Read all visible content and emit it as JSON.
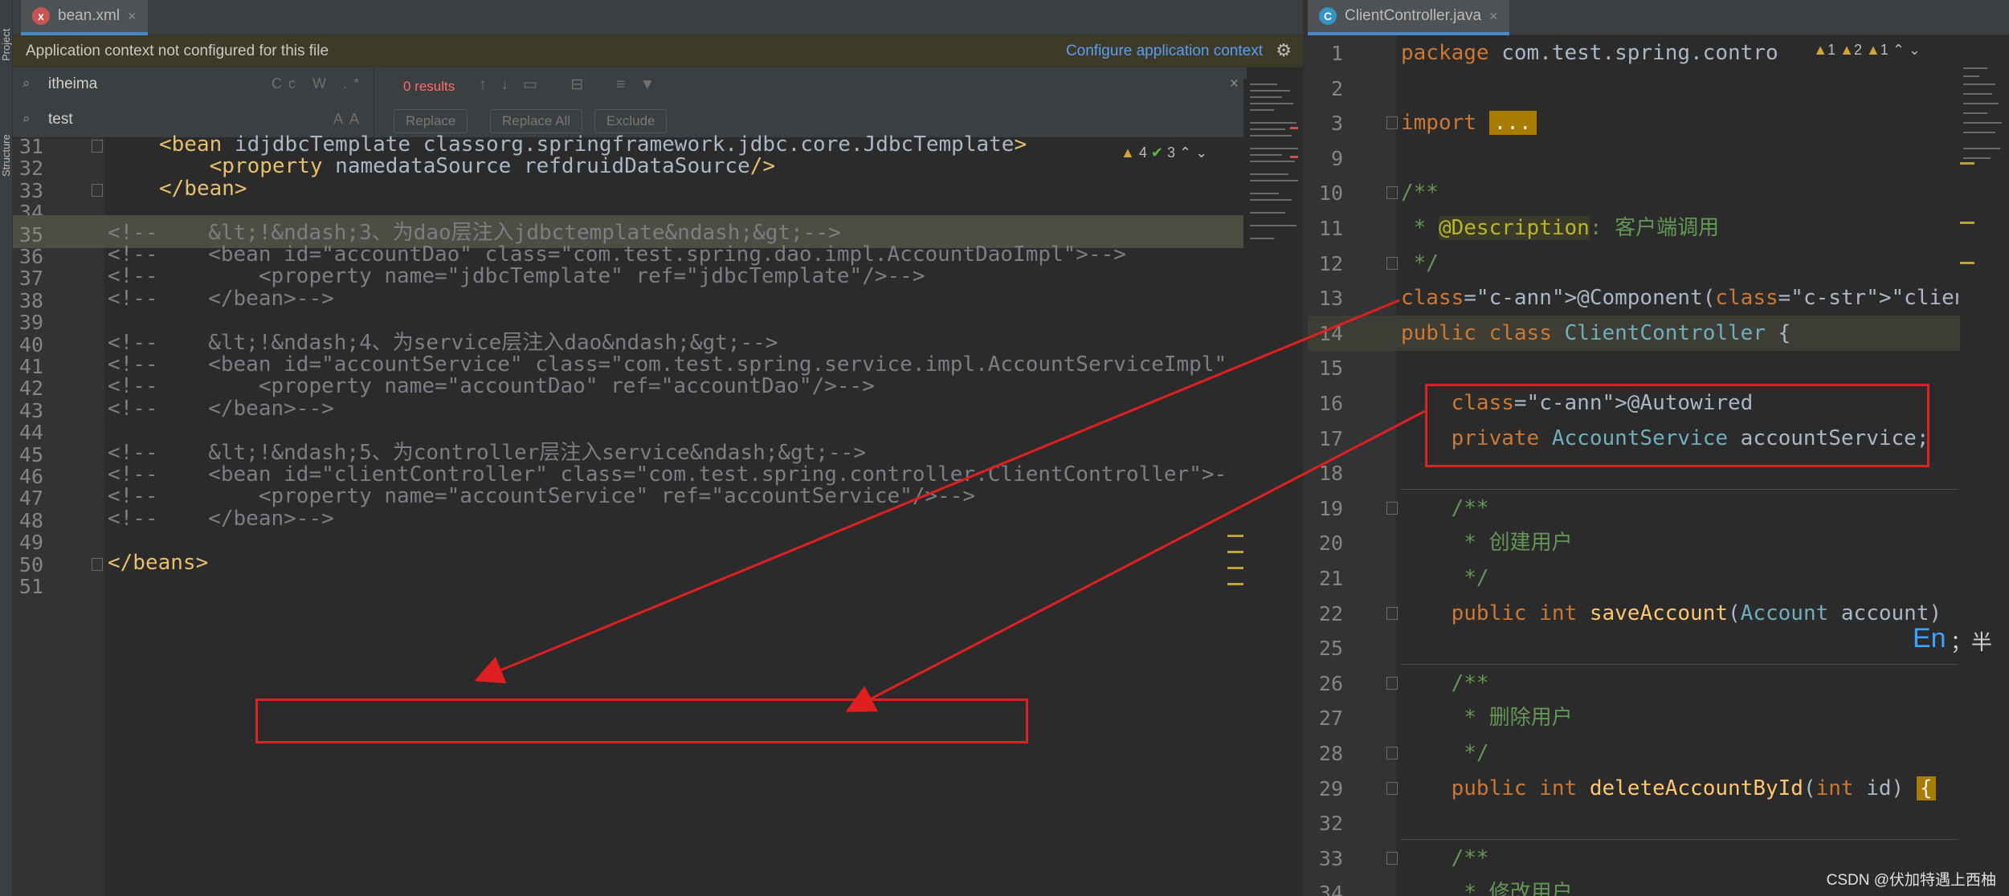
{
  "tool_strip": {
    "project_label": "Project",
    "structure_label": "Structure"
  },
  "left_tab": {
    "label": "bean.xml",
    "close": "×",
    "icon": "xml-file-icon"
  },
  "right_tab": {
    "label": "ClientController.java",
    "close": "×",
    "icon": "java-class-icon"
  },
  "banner": {
    "text": "Application context not configured for this file",
    "link": "Configure application context",
    "icon": "gear-icon"
  },
  "find": {
    "search_value": "itheima",
    "replace_value": "test",
    "results": "0 results",
    "search_opts": "Cc W .*",
    "replace_opts": "AA",
    "buttons": {
      "replace": "Replace",
      "replace_all": "Replace All",
      "exclude": "Exclude"
    },
    "close": "×"
  },
  "left_inspections": {
    "warnings": "4",
    "checks": "3"
  },
  "left_editor": {
    "lines": [
      {
        "n": "31",
        "code": "<bean id=\"jdbcTemplate\" class=\"org.springframework.jdbc.core.JdbcTemplate\">"
      },
      {
        "n": "32",
        "code": "    <property name=\"dataSource\" ref=\"druidDataSource\"/>"
      },
      {
        "n": "33",
        "code": "</bean>"
      },
      {
        "n": "34",
        "code": ""
      },
      {
        "n": "35",
        "code": "<!--    &lt;!&ndash;3、为dao层注入jdbctemplate&ndash;&gt;-->"
      },
      {
        "n": "36",
        "code": "<!--    <bean id=\"accountDao\" class=\"com.test.spring.dao.impl.AccountDaoImpl\">-->"
      },
      {
        "n": "37",
        "code": "<!--        <property name=\"jdbcTemplate\" ref=\"jdbcTemplate\"/>-->"
      },
      {
        "n": "38",
        "code": "<!--    </bean>-->"
      },
      {
        "n": "39",
        "code": ""
      },
      {
        "n": "40",
        "code": "<!--    &lt;!&ndash;4、为service层注入dao&ndash;&gt;-->"
      },
      {
        "n": "41",
        "code": "<!--    <bean id=\"accountService\" class=\"com.test.spring.service.impl.AccountServiceImpl\""
      },
      {
        "n": "42",
        "code": "<!--        <property name=\"accountDao\" ref=\"accountDao\"/>-->"
      },
      {
        "n": "43",
        "code": "<!--    </bean>-->"
      },
      {
        "n": "44",
        "code": ""
      },
      {
        "n": "45",
        "code": "<!--    &lt;!&ndash;5、为controller层注入service&ndash;&gt;-->"
      },
      {
        "n": "46",
        "code": "<!--    <bean id=\"clientController\" class=\"com.test.spring.controller.ClientController\">-"
      },
      {
        "n": "47",
        "code": "<!--        <property name=\"accountService\" ref=\"accountService\"/>-->"
      },
      {
        "n": "48",
        "code": "<!--    </bean>-->"
      },
      {
        "n": "49",
        "code": ""
      },
      {
        "n": "50",
        "code": "</beans>"
      },
      {
        "n": "51",
        "code": ""
      }
    ]
  },
  "right_inspections": {
    "warn1": "1",
    "warn2": "2",
    "warn3": "1"
  },
  "right_editor": {
    "lines": [
      {
        "n": "1",
        "code": "package com.test.spring.contro"
      },
      {
        "n": "2",
        "code": ""
      },
      {
        "n": "3",
        "code": "import ..."
      },
      {
        "n": "9",
        "code": ""
      },
      {
        "n": "10",
        "code": "/**"
      },
      {
        "n": "11",
        "code": " * @Description: 客户端调用"
      },
      {
        "n": "12",
        "code": " */"
      },
      {
        "n": "13",
        "code": "@Component(\"clientController\")"
      },
      {
        "n": "14",
        "code": "public class ClientController {"
      },
      {
        "n": "15",
        "code": ""
      },
      {
        "n": "16",
        "code": "    @Autowired"
      },
      {
        "n": "17",
        "code": "    private AccountService accountService;"
      },
      {
        "n": "18",
        "code": ""
      },
      {
        "n": "19",
        "code": "    /**"
      },
      {
        "n": "20",
        "code": "     * 创建用户"
      },
      {
        "n": "21",
        "code": "     */"
      },
      {
        "n": "22",
        "code": "    public int saveAccount(Account account)"
      },
      {
        "n": "25",
        "code": ""
      },
      {
        "n": "26",
        "code": "    /**"
      },
      {
        "n": "27",
        "code": "     * 删除用户"
      },
      {
        "n": "28",
        "code": "     */"
      },
      {
        "n": "29",
        "code": "    public int deleteAccountById(int id) {"
      },
      {
        "n": "32",
        "code": ""
      },
      {
        "n": "33",
        "code": "    /**"
      },
      {
        "n": "34",
        "code": "     * 修改用户"
      }
    ]
  },
  "ime": {
    "mode": "En",
    "extra": "；半"
  },
  "watermark": "CSDN @伏加特遇上西柚",
  "colors": {
    "annotation_red": "#e02020",
    "accent": "#4a88c7"
  }
}
